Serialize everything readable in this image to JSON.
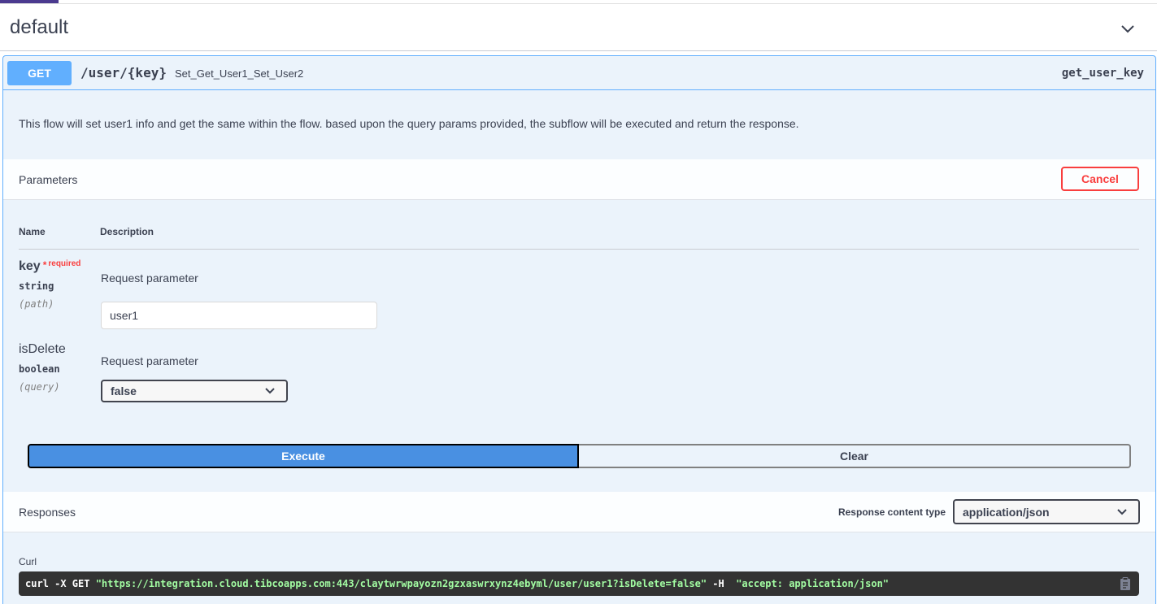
{
  "tag": {
    "title": "default"
  },
  "operation": {
    "method": "GET",
    "path": "/user/{key}",
    "summary": "Set_Get_User1_Set_User2",
    "operation_id": "get_user_key",
    "description": "This flow will set user1 info and get the same within the flow. based upon the query params provided, the subflow will be executed and return the response."
  },
  "parameters": {
    "title": "Parameters",
    "cancel_label": "Cancel",
    "col_name": "Name",
    "col_description": "Description",
    "items": [
      {
        "name": "key",
        "required_star": "*",
        "required_text": "required",
        "type": "string",
        "in": "(path)",
        "description": "Request parameter",
        "value": "user1"
      },
      {
        "name": "isDelete",
        "type": "boolean",
        "in": "(query)",
        "description": "Request parameter",
        "selected": "false"
      }
    ]
  },
  "actions": {
    "execute_label": "Execute",
    "clear_label": "Clear"
  },
  "responses": {
    "title": "Responses",
    "content_type_label": "Response content type",
    "content_type_value": "application/json"
  },
  "curl": {
    "label": "Curl",
    "prefix": "curl -X GET ",
    "url": "\"https://integration.cloud.tibcoapps.com:443/claytwrwpayozn2gzxaswrxynz4ebyml/user/user1?isDelete=false\"",
    "flag": " -H  ",
    "header": "\"accept: application/json\""
  },
  "colors": {
    "get": "#61affe",
    "execute": "#4990e2",
    "cancel": "#f93e3e",
    "curl_bg": "#333333",
    "curl_string": "#a2fca2"
  },
  "icons": {
    "tag_toggle": "chevron-down-icon",
    "copy": "clipboard-icon"
  }
}
